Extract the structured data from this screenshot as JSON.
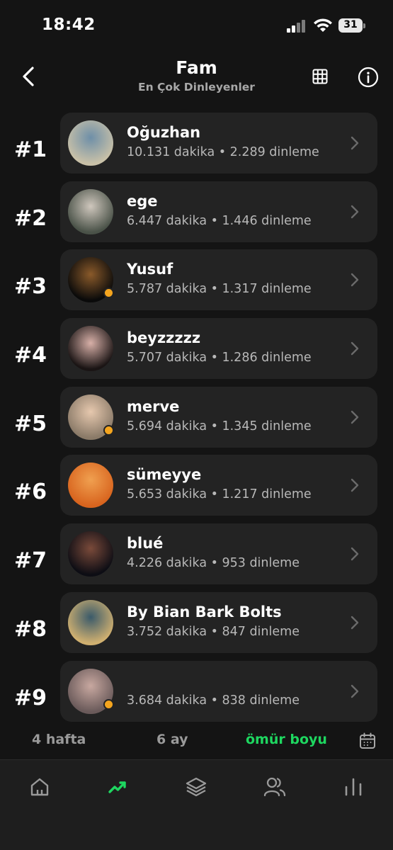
{
  "status_bar": {
    "time": "18:42",
    "battery": "31"
  },
  "header": {
    "title": "Fam",
    "subtitle": "En Çok Dinleyenler"
  },
  "listeners": [
    {
      "rank": "#1",
      "name": "Oğuzhan",
      "stats": "10.131 dakika • 2.289 dinleme",
      "online": false,
      "avatar_colors": [
        "#c9c1a8",
        "#6e8fa8"
      ]
    },
    {
      "rank": "#2",
      "name": "ege",
      "stats": "6.447 dakika • 1.446 dinleme",
      "online": false,
      "avatar_colors": [
        "#4a5248",
        "#cfc7bd"
      ]
    },
    {
      "rank": "#3",
      "name": "Yusuf",
      "stats": "5.787 dakika • 1.317 dinleme",
      "online": true,
      "avatar_colors": [
        "#0a0a0a",
        "#8a5a2a"
      ]
    },
    {
      "rank": "#4",
      "name": "beyzzzzz",
      "stats": "5.707 dakika • 1.286 dinleme",
      "online": false,
      "avatar_colors": [
        "#1a1414",
        "#d8b0a8"
      ]
    },
    {
      "rank": "#5",
      "name": "merve",
      "stats": "5.694 dakika • 1.345 dinleme",
      "online": true,
      "avatar_colors": [
        "#8a7a68",
        "#e6c8ae"
      ]
    },
    {
      "rank": "#6",
      "name": "sümeyye",
      "stats": "5.653 dakika • 1.217 dinleme",
      "online": false,
      "avatar_colors": [
        "#d8641e",
        "#f0a050"
      ]
    },
    {
      "rank": "#7",
      "name": "blué",
      "stats": "4.226 dakika • 953 dinleme",
      "online": false,
      "avatar_colors": [
        "#0d0d14",
        "#7a4a3a"
      ]
    },
    {
      "rank": "#8",
      "name": "By Bian Bark Bolts",
      "stats": "3.752 dakika • 847 dinleme",
      "online": false,
      "avatar_colors": [
        "#d0b070",
        "#3a5a6a"
      ]
    },
    {
      "rank": "#9",
      "name": "",
      "stats": "3.684 dakika • 838 dinleme",
      "online": true,
      "avatar_colors": [
        "#6a5a5a",
        "#c8a8a0"
      ]
    }
  ],
  "periods": {
    "week4": "4 hafta",
    "month6": "6 ay",
    "lifetime": "ömür boyu",
    "active": "lifetime"
  },
  "colors": {
    "accent": "#1ed760",
    "online_dot": "#f5a51e",
    "card": "#232323",
    "background": "#141414"
  },
  "nav": [
    "home-icon",
    "trending-icon",
    "layers-icon",
    "friends-icon",
    "stats-icon"
  ],
  "nav_active": "trending-icon"
}
